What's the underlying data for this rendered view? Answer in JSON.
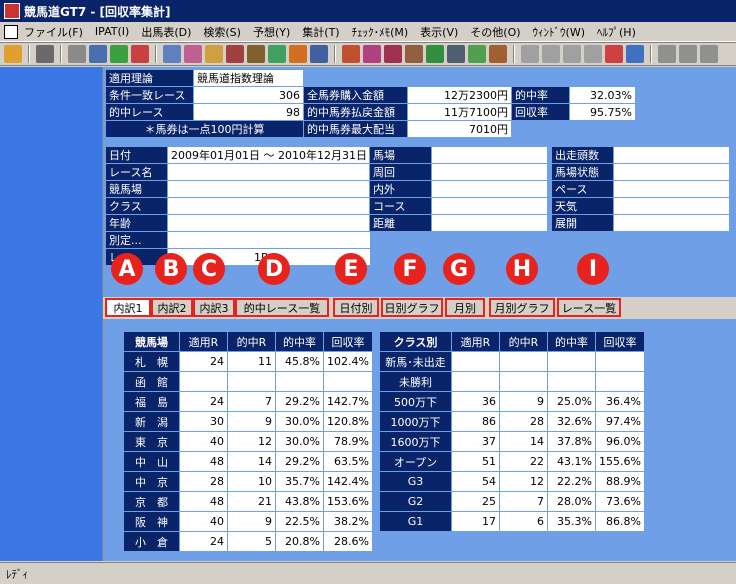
{
  "window": {
    "title": "競馬道GT7 - [回収率集計]"
  },
  "menu": [
    "ファイル(F)",
    "IPAT(I)",
    "出馬表(D)",
    "検索(S)",
    "予想(Y)",
    "集計(T)",
    "ﾁｪｯｸ･ﾒﾓ(M)",
    "表示(V)",
    "その他(O)",
    "ｳｨﾝﾄﾞｳ(W)",
    "ﾍﾙﾌﾟ(H)"
  ],
  "summary": {
    "theory_label": "適用理論",
    "theory_value": "競馬道指数理論",
    "match_label": "条件一致レース",
    "match_value": "306",
    "purchase_label": "全馬券購入金額",
    "purchase_value": "12万2300円",
    "hit_rate_label": "的中率",
    "hit_rate_value": "32.03%",
    "hit_race_label": "的中レース",
    "hit_race_value": "98",
    "payout_label": "的中馬券払戻金額",
    "payout_value": "11万7100円",
    "return_label": "回収率",
    "return_value": "95.75%",
    "note": "＊馬券は一点100円計算",
    "max_label": "的中馬券最大配当",
    "max_value": "7010円"
  },
  "conditions": {
    "date_label": "日付",
    "date_value": "2009年01月01日 〜 2010年12月31日",
    "race_label": "レース名",
    "course_place_label": "競馬場",
    "class_label": "クラス",
    "age_label": "年齢",
    "special_label": "別定...",
    "last_label": "レ",
    "last_value": "1R",
    "track_label": "馬場",
    "lap_label": "周回",
    "inout_label": "内外",
    "course_label": "コース",
    "distance_label": "距離",
    "runners_label": "出走頭数",
    "condition_label": "馬場状態",
    "pace_label": "ペース",
    "weather_label": "天気",
    "dev_label": "展開"
  },
  "badges": [
    "A",
    "B",
    "C",
    "D",
    "E",
    "F",
    "G",
    "H",
    "I"
  ],
  "tabs": [
    "内訳1",
    "内訳2",
    "内訳3",
    "的中レース一覧",
    "日付別",
    "日別グラフ",
    "月別",
    "月別グラフ",
    "レース一覧"
  ],
  "venue_table": {
    "headers": [
      "競馬場",
      "適用R",
      "的中R",
      "的中率",
      "回収率"
    ],
    "rows": [
      [
        "札　幌",
        "24",
        "11",
        "45.8%",
        "102.4%"
      ],
      [
        "函　館",
        "",
        "",
        "",
        ""
      ],
      [
        "福　島",
        "24",
        "7",
        "29.2%",
        "142.7%"
      ],
      [
        "新　潟",
        "30",
        "9",
        "30.0%",
        "120.8%"
      ],
      [
        "東　京",
        "40",
        "12",
        "30.0%",
        "78.9%"
      ],
      [
        "中　山",
        "48",
        "14",
        "29.2%",
        "63.5%"
      ],
      [
        "中　京",
        "28",
        "10",
        "35.7%",
        "142.4%"
      ],
      [
        "京　都",
        "48",
        "21",
        "43.8%",
        "153.6%"
      ],
      [
        "阪　神",
        "40",
        "9",
        "22.5%",
        "38.2%"
      ],
      [
        "小　倉",
        "24",
        "5",
        "20.8%",
        "28.6%"
      ]
    ]
  },
  "class_table": {
    "headers": [
      "クラス別",
      "適用R",
      "的中R",
      "的中率",
      "回収率"
    ],
    "rows": [
      [
        "新馬･未出走",
        "",
        "",
        "",
        ""
      ],
      [
        "未勝利",
        "",
        "",
        "",
        ""
      ],
      [
        "500万下",
        "36",
        "9",
        "25.0%",
        "36.4%"
      ],
      [
        "1000万下",
        "86",
        "28",
        "32.6%",
        "97.4%"
      ],
      [
        "1600万下",
        "37",
        "14",
        "37.8%",
        "96.0%"
      ],
      [
        "オープン",
        "51",
        "22",
        "43.1%",
        "155.6%"
      ],
      [
        "G3",
        "54",
        "12",
        "22.2%",
        "88.9%"
      ],
      [
        "G2",
        "25",
        "7",
        "28.0%",
        "73.6%"
      ],
      [
        "G1",
        "17",
        "6",
        "35.3%",
        "86.8%"
      ]
    ]
  },
  "status": {
    "text": "ﾚﾃﾞｨ"
  }
}
